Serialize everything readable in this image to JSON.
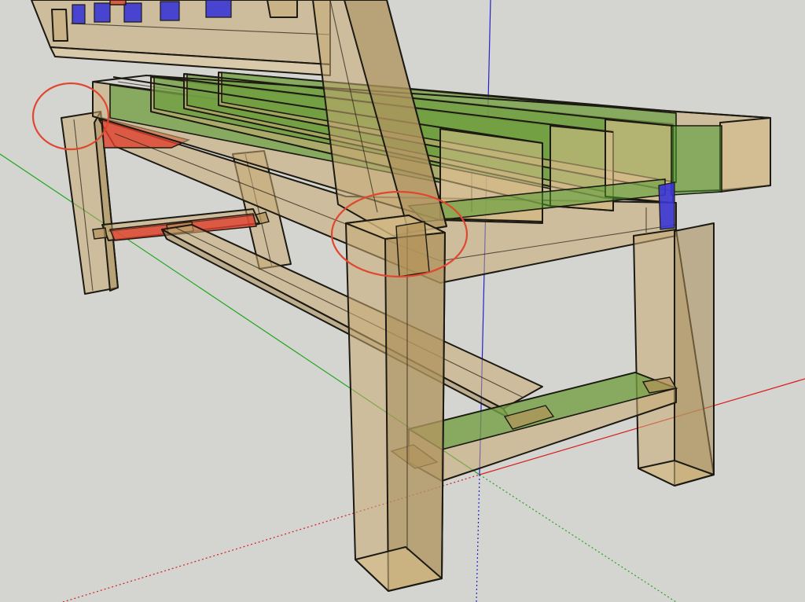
{
  "viewport": {
    "background": "#d4d4d0",
    "model": "bench",
    "axes": {
      "red": "#d81e1e",
      "green": "#1fa81f",
      "blue": "#2222cc"
    },
    "materials": {
      "wood": "#c6aa72",
      "edge": "#1c1a12",
      "selected_green": "#4f9a2e",
      "selected_red": "#e0402e",
      "selected_blue": "#3a36d6"
    },
    "highlight_circles": 2,
    "highlight_color": "#e0472f"
  }
}
